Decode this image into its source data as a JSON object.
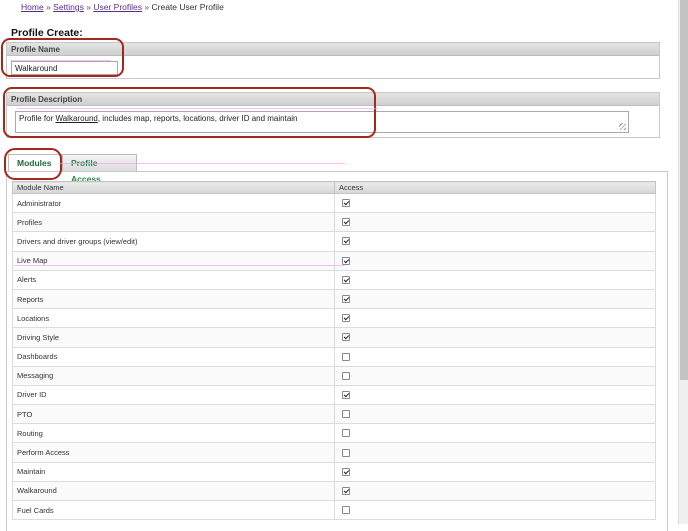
{
  "breadcrumb": {
    "home": "Home",
    "settings": "Settings",
    "user_profiles": "User Profiles",
    "current": "Create User Profile",
    "separator": "»"
  },
  "page": {
    "title": "Profile Create:"
  },
  "profile_name": {
    "header": "Profile Name",
    "value": "Walkaround"
  },
  "profile_description": {
    "header": "Profile Description",
    "text_before": "Profile for ",
    "text_underlined": "Walkaround",
    "text_after": ", includes map, reports, locations, driver ID and maintain"
  },
  "tabs": [
    {
      "label": "Modules",
      "active": true
    },
    {
      "label": "Profile Access",
      "active": false
    }
  ],
  "table": {
    "headers": [
      "Module Name",
      "Access"
    ],
    "rows": [
      {
        "name": "Administrator",
        "checked": true
      },
      {
        "name": "Profiles",
        "checked": true
      },
      {
        "name": "Drivers and driver groups (view/edit)",
        "checked": true
      },
      {
        "name": "Live Map",
        "checked": true
      },
      {
        "name": "Alerts",
        "checked": true
      },
      {
        "name": "Reports",
        "checked": true
      },
      {
        "name": "Locations",
        "checked": true
      },
      {
        "name": "Driving Style",
        "checked": true
      },
      {
        "name": "Dashboards",
        "checked": false
      },
      {
        "name": "Messaging",
        "checked": false
      },
      {
        "name": "Driver ID",
        "checked": true
      },
      {
        "name": "PTO",
        "checked": false
      },
      {
        "name": "Routing",
        "checked": false
      },
      {
        "name": "Perform Access",
        "checked": false
      },
      {
        "name": "Maintain",
        "checked": true
      },
      {
        "name": "Walkaround",
        "checked": true
      },
      {
        "name": "Fuel Cards",
        "checked": false
      }
    ]
  },
  "colors": {
    "annotation": "#a3281d",
    "tab_text": "#2a8a4a",
    "link": "#5a2d8a"
  }
}
